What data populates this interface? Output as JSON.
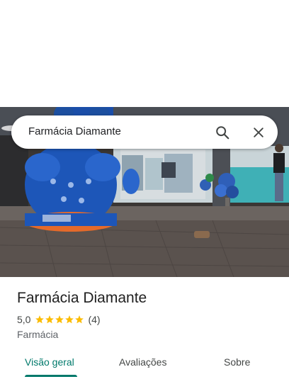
{
  "search": {
    "query": "Farmácia Diamante",
    "search_icon": "search-icon",
    "close_icon": "close-icon"
  },
  "place": {
    "name": "Farmácia Diamante",
    "rating": "5,0",
    "stars": 5,
    "reviews_count": "(4)",
    "category": "Farmácia"
  },
  "tabs": [
    {
      "label": "Visão geral",
      "active": true
    },
    {
      "label": "Avaliações",
      "active": false
    },
    {
      "label": "Sobre",
      "active": false
    }
  ],
  "colors": {
    "accent": "#00796b",
    "star": "#fbbc04",
    "text_secondary": "#5f6368"
  }
}
